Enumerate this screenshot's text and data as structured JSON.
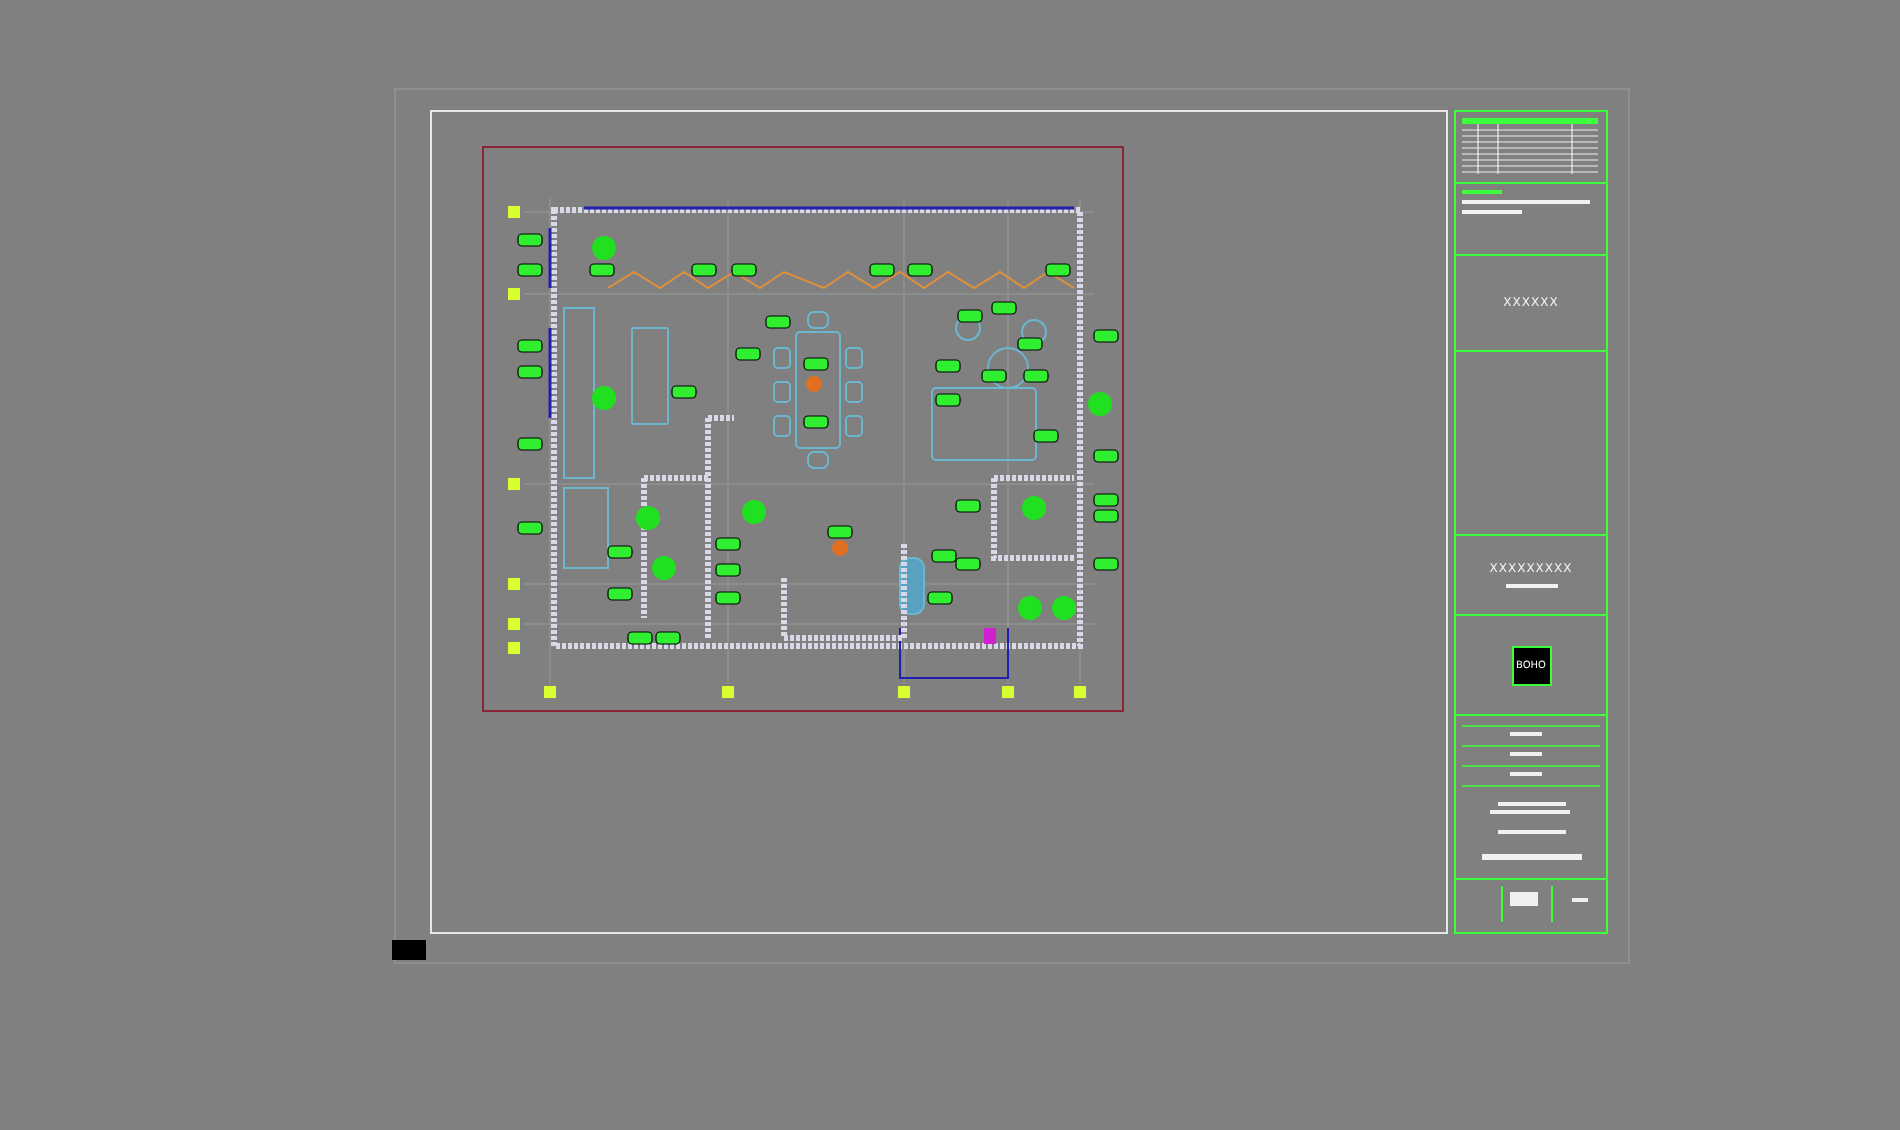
{
  "title_block": {
    "project_code": "XXXXXX",
    "drawing_code": "XXXXXXXXX",
    "logo": "BOHO"
  }
}
